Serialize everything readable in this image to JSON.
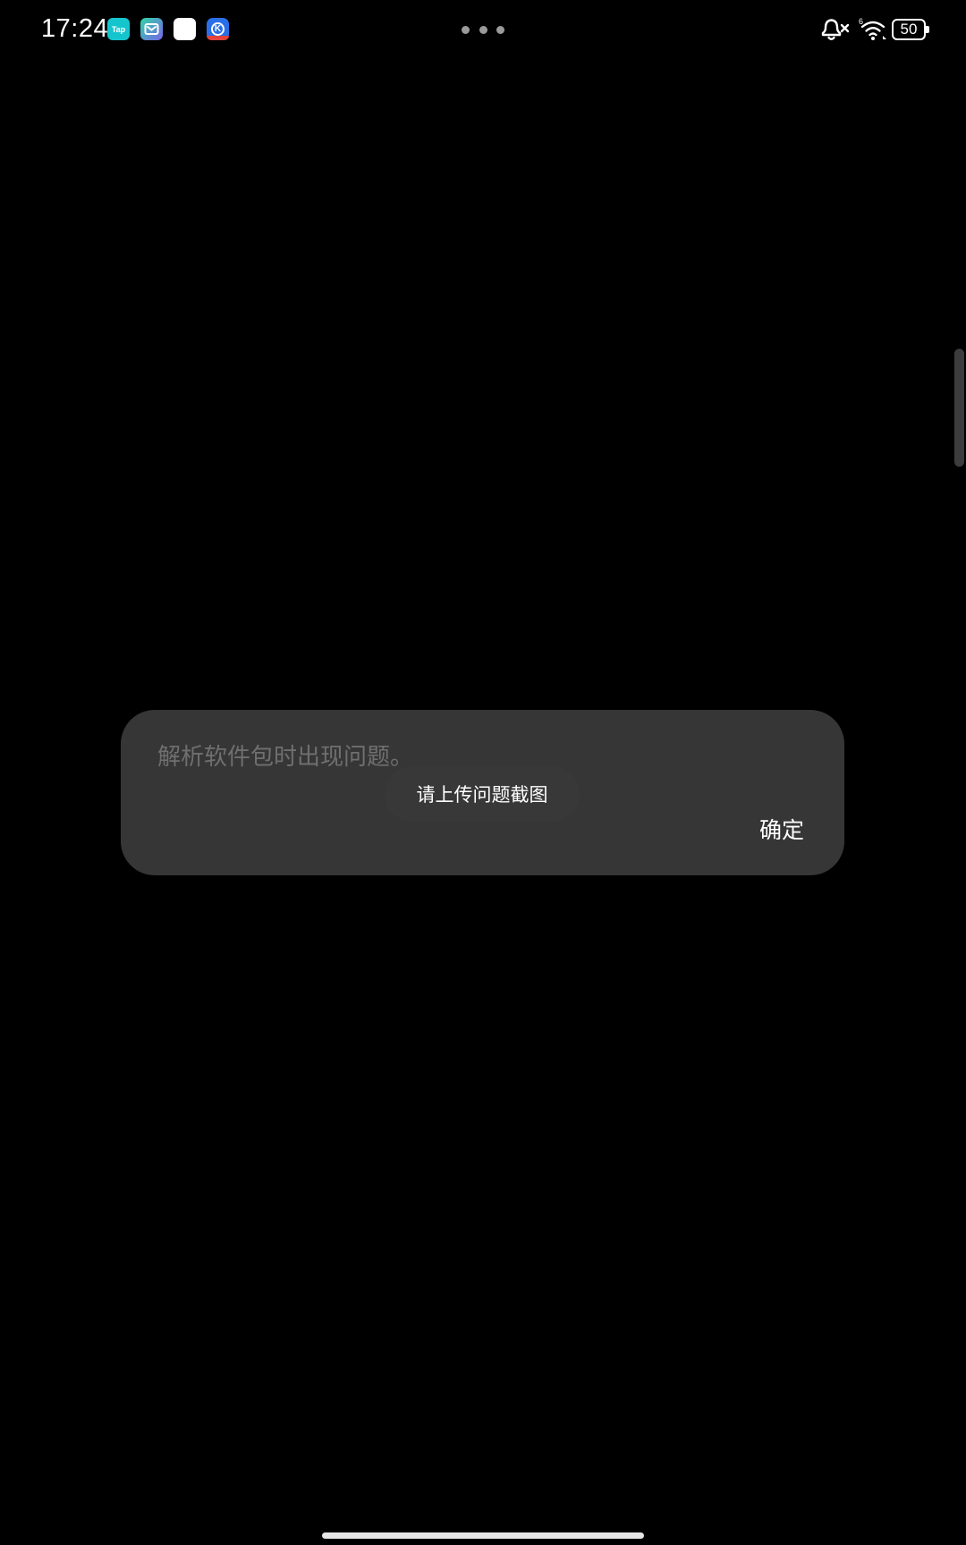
{
  "status_bar": {
    "time": "17:24",
    "app_icons": [
      {
        "name": "taptap-icon",
        "label": "Tap",
        "color": "#15c5ce"
      },
      {
        "name": "mail-app-icon",
        "color": "#2fd6a6"
      },
      {
        "name": "blank-app-icon",
        "color": "#ffffff"
      },
      {
        "name": "k-app-icon",
        "label": "K",
        "color": "#2a6fe6"
      }
    ],
    "wifi_badge": "6",
    "battery_level": "50"
  },
  "dialog": {
    "message": "解析软件包时出现问题。",
    "ok_label": "确定"
  },
  "toast": {
    "text": "请上传问题截图"
  },
  "colors": {
    "background": "#000000",
    "dialog_background": "#363636",
    "message_text": "#6f6f6f",
    "toast_background": "#383838"
  }
}
